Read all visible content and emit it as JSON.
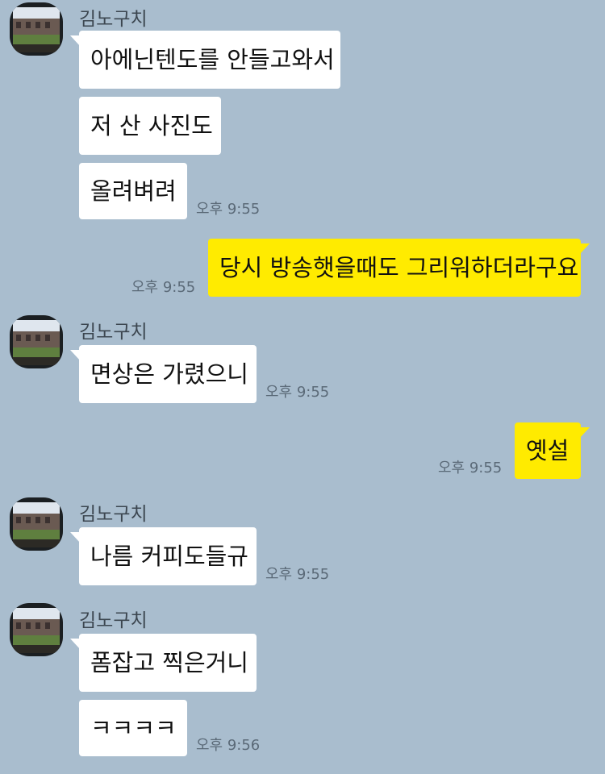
{
  "sender_name": "김노구치",
  "messages": [
    {
      "text": "아에닌텐도를 안들고와서"
    },
    {
      "text": "저 산 사진도"
    },
    {
      "text": "올려벼려",
      "time": "오후 9:55"
    },
    {
      "text": "당시 방송햇을때도 그리워하더라구요",
      "time": "오후 9:55"
    },
    {
      "text": "면상은 가렸으니",
      "time": "오후 9:55"
    },
    {
      "text": "옛설",
      "time": "오후 9:55"
    },
    {
      "text": "나름 커피도들규",
      "time": "오후 9:55"
    },
    {
      "text": "폼잡고 찍은거니"
    },
    {
      "text": "ㅋㅋㅋㅋ",
      "time": "오후 9:56"
    }
  ],
  "colors": {
    "background": "#a9bdce",
    "incoming_bubble": "#ffffff",
    "outgoing_bubble": "#ffeb00"
  },
  "icons": {
    "avatar": "profile-photo-courtyard"
  }
}
